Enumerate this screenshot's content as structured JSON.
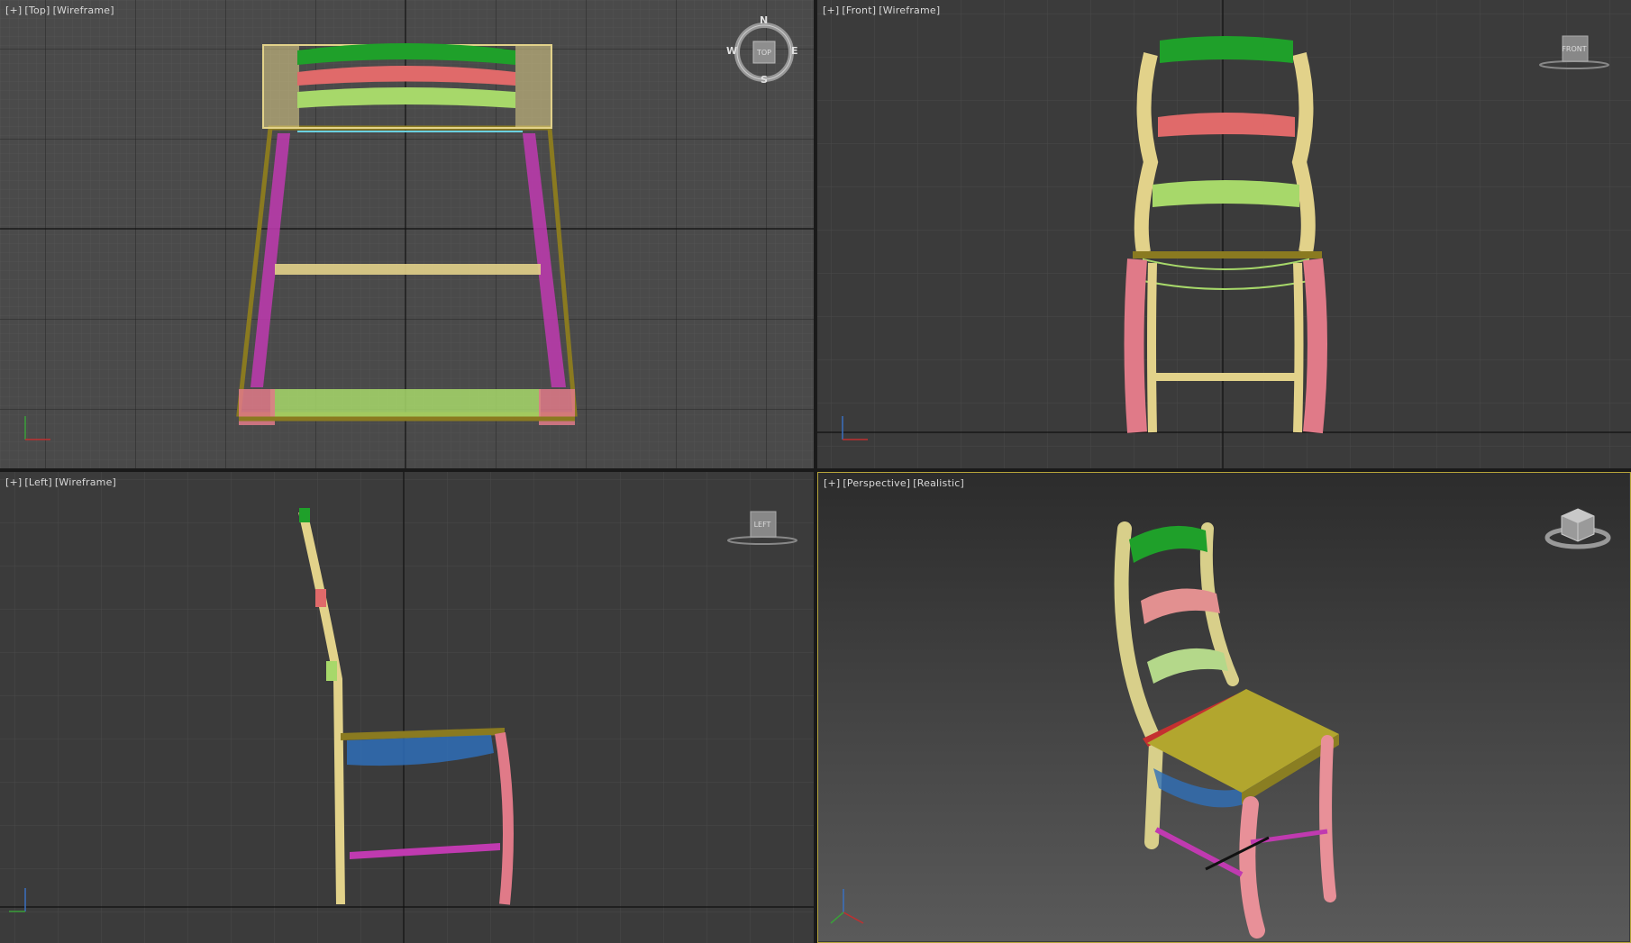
{
  "viewports": {
    "top": {
      "plus": "[+]",
      "view": "[Top]",
      "shading": "[Wireframe]",
      "cube_label": "TOP",
      "compass": {
        "n": "N",
        "s": "S",
        "e": "E",
        "w": "W"
      }
    },
    "front": {
      "plus": "[+]",
      "view": "[Front]",
      "shading": "[Wireframe]",
      "cube_label": "FRONT"
    },
    "left": {
      "plus": "[+]",
      "view": "[Left]",
      "shading": "[Wireframe]",
      "cube_label": "LEFT"
    },
    "perspective": {
      "plus": "[+]",
      "view": "[Perspective]",
      "shading": "[Realistic]",
      "active": true
    }
  },
  "colors": {
    "viewport_bg": "#3b3b3b",
    "grid_minor": "#474747",
    "grid_major": "#2a2a2a",
    "active_border": "#b6a43a",
    "chair_back_top_rail": "#1fa02a",
    "chair_back_mid_rail": "#e06a6a",
    "chair_back_low_rail": "#a7d86a",
    "chair_back_posts": "#e2d28a",
    "chair_seat": "#a89a30",
    "chair_front_legs": "#e07a88",
    "chair_stretcher": "#c03ab0",
    "chair_seat_skirt": "#2f6fb8"
  }
}
